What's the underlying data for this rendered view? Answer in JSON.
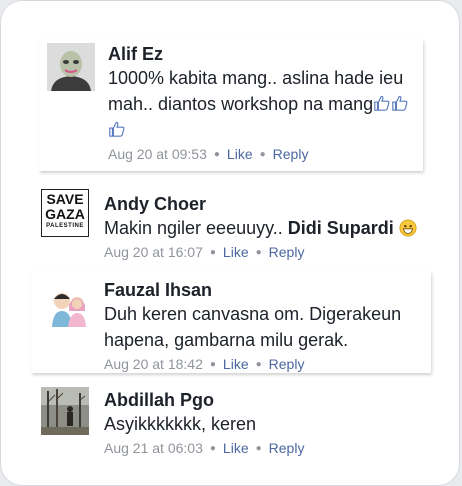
{
  "comments": [
    {
      "name": "Alif Ez",
      "text": "1000% kabita mang.. aslina hade ieu mah.. diantos workshop na mang",
      "time": "Aug 20 at 09:53",
      "like": "Like",
      "reply": "Reply",
      "avatar_icon": "person-masked-avatar-icon"
    },
    {
      "name": "Andy Choer",
      "text": "Makin ngiler eeeuuyy..",
      "mention": "Didi Supardi",
      "time": "Aug 20 at 16:07",
      "like": "Like",
      "reply": "Reply",
      "avatar": {
        "line1": "SAVE",
        "line2": "GAZA",
        "line3": "PALESTINE"
      }
    },
    {
      "name": "Fauzal Ihsan",
      "text": "Duh keren canvasna om. Digerakeun hapena, gambarna milu gerak.",
      "time": "Aug 20 at 18:42",
      "like": "Like",
      "reply": "Reply",
      "avatar_icon": "cartoon-couple-avatar-icon"
    },
    {
      "name": "Abdillah Pgo",
      "text": "Asyikkkkkkk, keren",
      "time": "Aug 21 at 06:03",
      "like": "Like",
      "reply": "Reply",
      "avatar_icon": "forest-photo-avatar-icon"
    }
  ],
  "colors": {
    "name": "#1d2129",
    "meta": "#90949c",
    "link": "#4b67a1",
    "thumb": "#5b7bc0"
  }
}
